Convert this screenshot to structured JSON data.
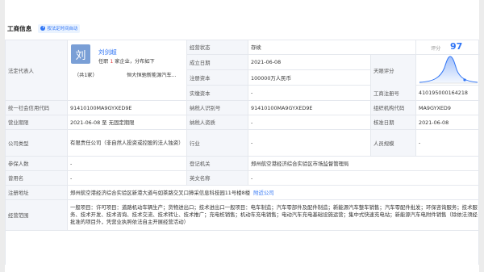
{
  "section": {
    "title": "工商信息",
    "badge": "按法定时间自动"
  },
  "legal_rep": {
    "label": "法定代表人",
    "avatar_char": "刘",
    "name": "刘剑超",
    "role_prefix": "任职",
    "role_count": "1",
    "role_suffix": "家企业，分布如下",
    "count_text": "（共1家）",
    "company": "恒大恒驰新能源汽车..."
  },
  "rows": {
    "status": {
      "label": "经营状态",
      "value": "存续"
    },
    "founded": {
      "label": "成立日期",
      "value": "2021-06-08"
    },
    "capital": {
      "label": "注册资本",
      "value": "100000万人民币"
    },
    "paid_capital": {
      "label": "实缴资本",
      "value": "-"
    },
    "sky_score": {
      "label": "天眼评分",
      "score_label": "评分",
      "score": "97"
    },
    "reg_no": {
      "label": "工商注册号",
      "value": "410195000164218"
    },
    "credit_code": {
      "label": "统一社会信用代码",
      "value": "91410100MA9GYXED9E"
    },
    "taxpayer_id": {
      "label": "纳税人识别号",
      "value": "91410100MA9GYXED9E"
    },
    "org_code": {
      "label": "组织机构代码",
      "value": "MA9GYXED9"
    },
    "term": {
      "label": "营业期限",
      "value": "2021-06-08 至 无固定期限"
    },
    "taxpayer_qual": {
      "label": "纳税人资质",
      "value": "-"
    },
    "approval_date": {
      "label": "核准日期",
      "value": "2021-06-08"
    },
    "company_type": {
      "label": "公司类型",
      "value": "有限责任公司（非自然人投资或控股的法人独资）"
    },
    "industry": {
      "label": "行业",
      "value": "-"
    },
    "staff_size": {
      "label": "人员规模",
      "value": "-"
    },
    "insured": {
      "label": "参保人数",
      "value": "-"
    },
    "reg_authority": {
      "label": "登记机关",
      "value": "郑州航空港经济综合实验区市场监督管理局"
    },
    "former_name": {
      "label": "曾用名",
      "value": "-"
    },
    "english_name": {
      "label": "英文名称",
      "value": "-"
    },
    "address": {
      "label": "注册地址",
      "value": "郑州航空港经济综合实验区新港大道与如茶路交叉口獐采信息科技园11号楼8楼",
      "link": "附近公司"
    },
    "scope": {
      "label": "经营范围",
      "value": "一般项目：许可项目：道路机动车辆生产；货物进出口；技术进出口一般项目：电车制造；汽车零部件及配件制造；新能源汽车整车销售；汽车零配件批发；环保咨询服务；技术服务、技术开发、技术咨询、技术交流、技术转让、技术推广；充电桩销售；机动车充电销售；电动汽车充电基础设施运营；集中式快速充电站；新能源汽车电附件销售（除依法须经批准的项目外，凭营业执照依法自主开展经营活动）"
    }
  },
  "colors": {
    "accent": "#2f74f5",
    "label_bg": "#f4f6fa",
    "border": "#e5e8ee"
  },
  "icons": {
    "badge": "info-icon",
    "score_curve": "bell-curve-chart"
  }
}
